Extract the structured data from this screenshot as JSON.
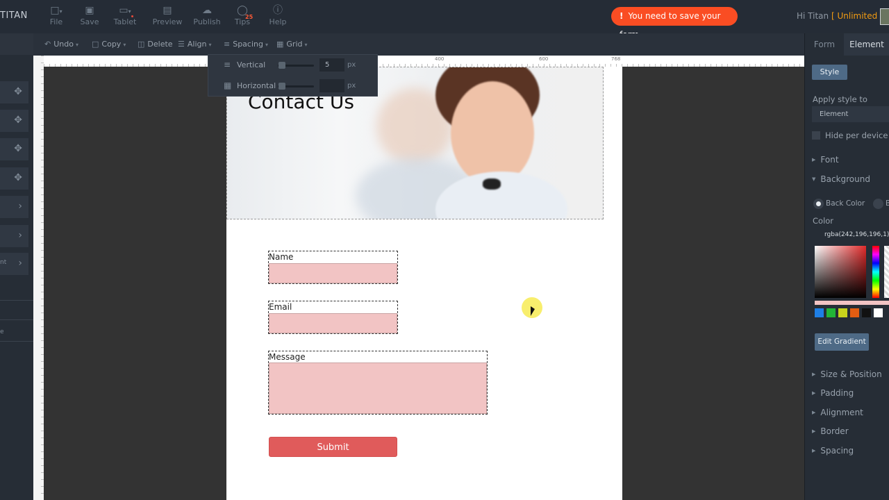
{
  "app": {
    "brand": "TITAN",
    "greeting": "Hi Titan",
    "plan": "[ Unlimited ]",
    "alert": "You need to save your form"
  },
  "topbar": {
    "file": "File",
    "save": "Save",
    "tablet": "Tablet",
    "preview": "Preview",
    "publish": "Publish",
    "tips": "Tips",
    "tips_count": "25",
    "help": "Help"
  },
  "toolbar": {
    "undo": "Undo",
    "copy": "Copy",
    "delete": "Delete",
    "align": "Align",
    "spacing": "Spacing",
    "grid": "Grid"
  },
  "spacing_popup": {
    "vertical_label": "Vertical",
    "vertical_value": "5",
    "horizontal_label": "Horizontal",
    "horizontal_value": "",
    "unit": "px"
  },
  "rulers": {
    "h_labels": [
      "400",
      "600",
      "768"
    ]
  },
  "canvas": {
    "hero_title": "Contact Us",
    "fields": [
      {
        "label": "Name",
        "type": "text"
      },
      {
        "label": "Email",
        "type": "text"
      },
      {
        "label": "Message",
        "type": "textarea"
      }
    ],
    "submit_label": "Submit",
    "input_color": "#f2c4c4",
    "button_color": "#e05b5b"
  },
  "left_rail": {
    "partial_labels": [
      "nt",
      "e"
    ]
  },
  "right_panel": {
    "tabs": [
      "Form",
      "Element"
    ],
    "active_tab": "Element",
    "style_button": "Style",
    "apply_style_label": "Apply style to",
    "apply_style_value": "Element",
    "hide_per_device": "Hide per device",
    "sections_top": [
      "Font",
      "Background"
    ],
    "back_color_label": "Back Color",
    "color_label": "Color",
    "color_value": "rgba(242,196,196,1)",
    "swatches": [
      "#1e7fe6",
      "#22b537",
      "#c8d41c",
      "#e25d12",
      "#111111",
      "#ffffff"
    ],
    "edit_gradient": "Edit Gradient",
    "sections_bottom": [
      "Size & Position",
      "Padding",
      "Alignment",
      "Border",
      "Spacing"
    ]
  }
}
